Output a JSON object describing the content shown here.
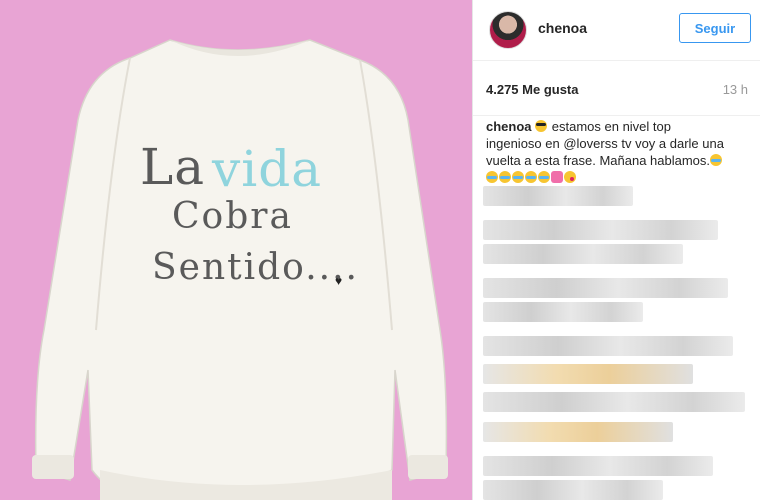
{
  "photo": {
    "line1_a": "La",
    "line1_b": "vida",
    "line2": "Cobra",
    "line3": "Sentido....",
    "heart": "♥",
    "background_color": "#e8a4d4",
    "accent_color": "#8fd4dd"
  },
  "header": {
    "username": "chenoa",
    "follow_label": "Seguir",
    "accent_color": "#3897f0"
  },
  "stats": {
    "likes": "4.275 Me gusta",
    "time": "13 h"
  },
  "caption": {
    "username": "chenoa",
    "text_1": " estamos en nivel top ingenioso en ",
    "mention": "@loverss tv",
    "text_2": " voy a darle una vuelta a esta frase. Mañana hablamos."
  }
}
